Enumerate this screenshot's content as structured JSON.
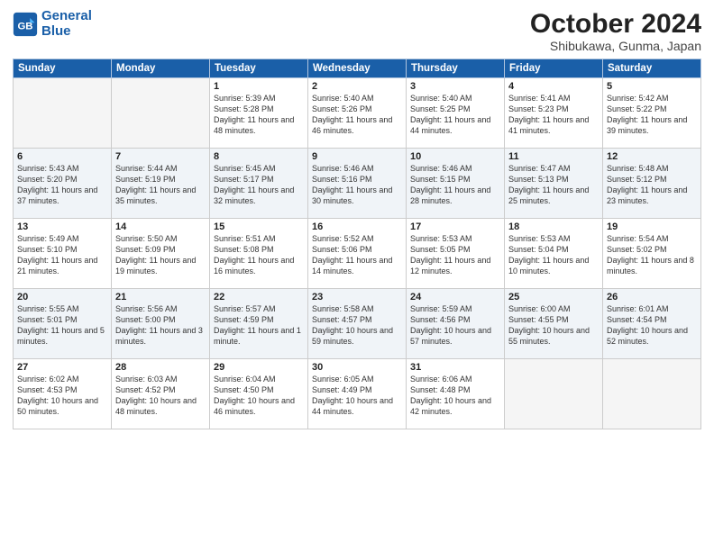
{
  "logo": {
    "line1": "General",
    "line2": "Blue"
  },
  "title": "October 2024",
  "subtitle": "Shibukawa, Gunma, Japan",
  "days_of_week": [
    "Sunday",
    "Monday",
    "Tuesday",
    "Wednesday",
    "Thursday",
    "Friday",
    "Saturday"
  ],
  "weeks": [
    [
      {
        "day": "",
        "empty": true
      },
      {
        "day": "",
        "empty": true
      },
      {
        "day": "1",
        "sunrise": "Sunrise: 5:39 AM",
        "sunset": "Sunset: 5:28 PM",
        "daylight": "Daylight: 11 hours and 48 minutes."
      },
      {
        "day": "2",
        "sunrise": "Sunrise: 5:40 AM",
        "sunset": "Sunset: 5:26 PM",
        "daylight": "Daylight: 11 hours and 46 minutes."
      },
      {
        "day": "3",
        "sunrise": "Sunrise: 5:40 AM",
        "sunset": "Sunset: 5:25 PM",
        "daylight": "Daylight: 11 hours and 44 minutes."
      },
      {
        "day": "4",
        "sunrise": "Sunrise: 5:41 AM",
        "sunset": "Sunset: 5:23 PM",
        "daylight": "Daylight: 11 hours and 41 minutes."
      },
      {
        "day": "5",
        "sunrise": "Sunrise: 5:42 AM",
        "sunset": "Sunset: 5:22 PM",
        "daylight": "Daylight: 11 hours and 39 minutes."
      }
    ],
    [
      {
        "day": "6",
        "sunrise": "Sunrise: 5:43 AM",
        "sunset": "Sunset: 5:20 PM",
        "daylight": "Daylight: 11 hours and 37 minutes."
      },
      {
        "day": "7",
        "sunrise": "Sunrise: 5:44 AM",
        "sunset": "Sunset: 5:19 PM",
        "daylight": "Daylight: 11 hours and 35 minutes."
      },
      {
        "day": "8",
        "sunrise": "Sunrise: 5:45 AM",
        "sunset": "Sunset: 5:17 PM",
        "daylight": "Daylight: 11 hours and 32 minutes."
      },
      {
        "day": "9",
        "sunrise": "Sunrise: 5:46 AM",
        "sunset": "Sunset: 5:16 PM",
        "daylight": "Daylight: 11 hours and 30 minutes."
      },
      {
        "day": "10",
        "sunrise": "Sunrise: 5:46 AM",
        "sunset": "Sunset: 5:15 PM",
        "daylight": "Daylight: 11 hours and 28 minutes."
      },
      {
        "day": "11",
        "sunrise": "Sunrise: 5:47 AM",
        "sunset": "Sunset: 5:13 PM",
        "daylight": "Daylight: 11 hours and 25 minutes."
      },
      {
        "day": "12",
        "sunrise": "Sunrise: 5:48 AM",
        "sunset": "Sunset: 5:12 PM",
        "daylight": "Daylight: 11 hours and 23 minutes."
      }
    ],
    [
      {
        "day": "13",
        "sunrise": "Sunrise: 5:49 AM",
        "sunset": "Sunset: 5:10 PM",
        "daylight": "Daylight: 11 hours and 21 minutes."
      },
      {
        "day": "14",
        "sunrise": "Sunrise: 5:50 AM",
        "sunset": "Sunset: 5:09 PM",
        "daylight": "Daylight: 11 hours and 19 minutes."
      },
      {
        "day": "15",
        "sunrise": "Sunrise: 5:51 AM",
        "sunset": "Sunset: 5:08 PM",
        "daylight": "Daylight: 11 hours and 16 minutes."
      },
      {
        "day": "16",
        "sunrise": "Sunrise: 5:52 AM",
        "sunset": "Sunset: 5:06 PM",
        "daylight": "Daylight: 11 hours and 14 minutes."
      },
      {
        "day": "17",
        "sunrise": "Sunrise: 5:53 AM",
        "sunset": "Sunset: 5:05 PM",
        "daylight": "Daylight: 11 hours and 12 minutes."
      },
      {
        "day": "18",
        "sunrise": "Sunrise: 5:53 AM",
        "sunset": "Sunset: 5:04 PM",
        "daylight": "Daylight: 11 hours and 10 minutes."
      },
      {
        "day": "19",
        "sunrise": "Sunrise: 5:54 AM",
        "sunset": "Sunset: 5:02 PM",
        "daylight": "Daylight: 11 hours and 8 minutes."
      }
    ],
    [
      {
        "day": "20",
        "sunrise": "Sunrise: 5:55 AM",
        "sunset": "Sunset: 5:01 PM",
        "daylight": "Daylight: 11 hours and 5 minutes."
      },
      {
        "day": "21",
        "sunrise": "Sunrise: 5:56 AM",
        "sunset": "Sunset: 5:00 PM",
        "daylight": "Daylight: 11 hours and 3 minutes."
      },
      {
        "day": "22",
        "sunrise": "Sunrise: 5:57 AM",
        "sunset": "Sunset: 4:59 PM",
        "daylight": "Daylight: 11 hours and 1 minute."
      },
      {
        "day": "23",
        "sunrise": "Sunrise: 5:58 AM",
        "sunset": "Sunset: 4:57 PM",
        "daylight": "Daylight: 10 hours and 59 minutes."
      },
      {
        "day": "24",
        "sunrise": "Sunrise: 5:59 AM",
        "sunset": "Sunset: 4:56 PM",
        "daylight": "Daylight: 10 hours and 57 minutes."
      },
      {
        "day": "25",
        "sunrise": "Sunrise: 6:00 AM",
        "sunset": "Sunset: 4:55 PM",
        "daylight": "Daylight: 10 hours and 55 minutes."
      },
      {
        "day": "26",
        "sunrise": "Sunrise: 6:01 AM",
        "sunset": "Sunset: 4:54 PM",
        "daylight": "Daylight: 10 hours and 52 minutes."
      }
    ],
    [
      {
        "day": "27",
        "sunrise": "Sunrise: 6:02 AM",
        "sunset": "Sunset: 4:53 PM",
        "daylight": "Daylight: 10 hours and 50 minutes."
      },
      {
        "day": "28",
        "sunrise": "Sunrise: 6:03 AM",
        "sunset": "Sunset: 4:52 PM",
        "daylight": "Daylight: 10 hours and 48 minutes."
      },
      {
        "day": "29",
        "sunrise": "Sunrise: 6:04 AM",
        "sunset": "Sunset: 4:50 PM",
        "daylight": "Daylight: 10 hours and 46 minutes."
      },
      {
        "day": "30",
        "sunrise": "Sunrise: 6:05 AM",
        "sunset": "Sunset: 4:49 PM",
        "daylight": "Daylight: 10 hours and 44 minutes."
      },
      {
        "day": "31",
        "sunrise": "Sunrise: 6:06 AM",
        "sunset": "Sunset: 4:48 PM",
        "daylight": "Daylight: 10 hours and 42 minutes."
      },
      {
        "day": "",
        "empty": true
      },
      {
        "day": "",
        "empty": true
      }
    ]
  ]
}
